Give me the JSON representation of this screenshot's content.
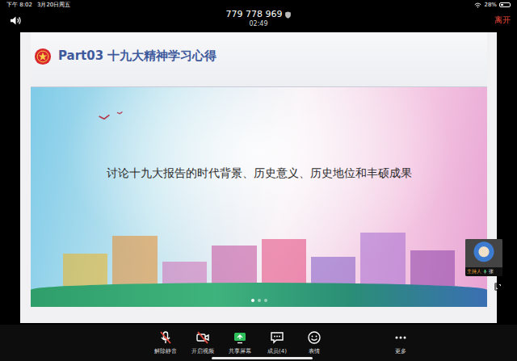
{
  "status_bar": {
    "time": "下午 8:02",
    "date": "3月20日周五",
    "battery": "28%"
  },
  "meeting": {
    "id": "779 778 969",
    "duration": "02:49",
    "leave_button": "离开"
  },
  "slide": {
    "title": "Part03 十九大精神学习心得",
    "banner_text": "讨论十九大报告的时代背景、历史意义、历史地位和丰硕成果",
    "pages": [
      {
        "selected": true
      },
      {
        "selected": false
      },
      {
        "selected": false
      }
    ]
  },
  "host": {
    "role": "主持人",
    "name": "张",
    "mic_on": true
  },
  "toolbar": [
    {
      "label": "解除静音",
      "kind": "mic",
      "crossed": true
    },
    {
      "label": "开启视频",
      "kind": "video",
      "crossed": true
    },
    {
      "label": "共享屏幕",
      "kind": "share",
      "crossed": false
    },
    {
      "label": "成员(4)",
      "kind": "members",
      "crossed": false
    },
    {
      "label": "表情",
      "kind": "emoji",
      "crossed": false
    },
    {
      "label": "更多",
      "kind": "more",
      "crossed": false
    }
  ]
}
